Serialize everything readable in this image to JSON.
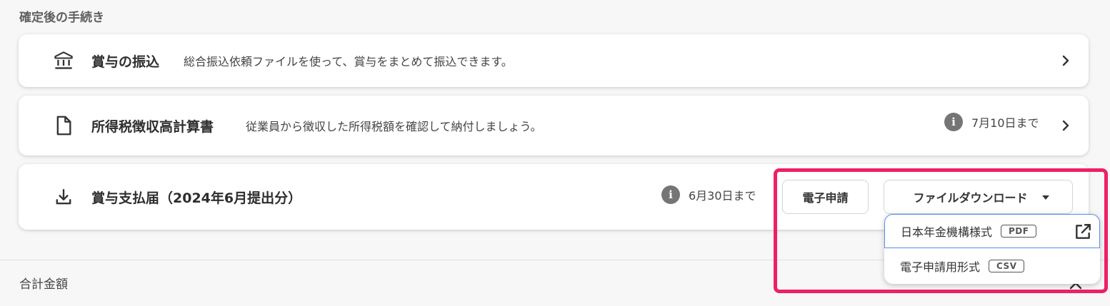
{
  "section": {
    "title": "確定後の手続き"
  },
  "cards": [
    {
      "icon": "bank-icon",
      "title": "賞与の振込",
      "description": "総合振込依頼ファイルを使って、賞与をまとめて振込できます。"
    },
    {
      "icon": "document-icon",
      "title": "所得税徴収高計算書",
      "description": "従業員から徴収した所得税額を確認して納付しましょう。",
      "deadline": "7月10日まで"
    },
    {
      "icon": "download-icon",
      "title": "賞与支払届（2024年6月提出分）",
      "deadline": "6月30日まで",
      "efile_label": "電子申請",
      "download_label": "ファイルダウンロード"
    }
  ],
  "dropdown": {
    "items": [
      {
        "label": "日本年金機構様式",
        "tag": "PDF",
        "icon": "external-link-icon"
      },
      {
        "label": "電子申請用形式",
        "tag": "CSV"
      }
    ]
  },
  "footer": {
    "total_label": "合計金額"
  },
  "colors": {
    "highlight": "#ee1f67",
    "focus": "#5b8def",
    "info": "#757575"
  }
}
